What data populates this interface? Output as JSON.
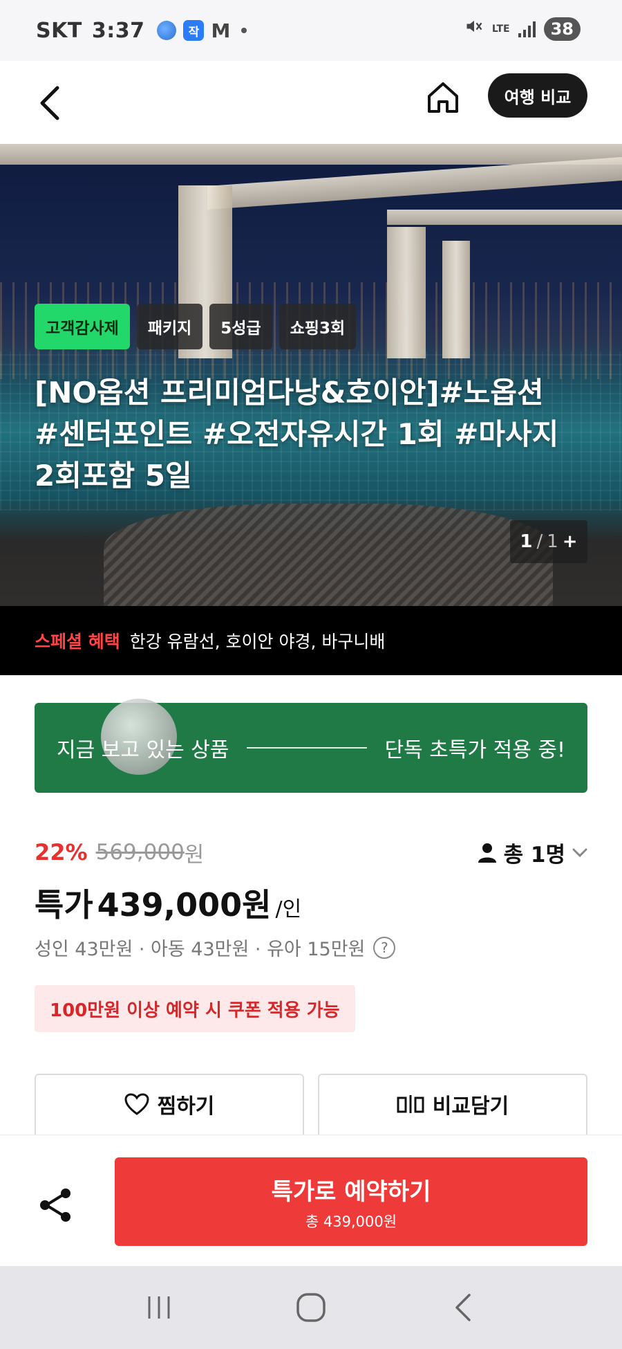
{
  "status_bar": {
    "carrier": "SKT",
    "time": "3:37",
    "app_icon_label": "작",
    "mail_icon_label": "M",
    "network": "LTE",
    "battery": "38",
    "icons": [
      "globe-icon",
      "app-icon",
      "gmail-icon",
      "notification-dot",
      "mute-icon",
      "lte-icon",
      "signal-icon",
      "battery-icon"
    ]
  },
  "header": {
    "back_icon": "chevron-left-icon",
    "home_icon": "home-icon",
    "compare_label": "여행 비교"
  },
  "hero": {
    "tags": [
      "고객감사제",
      "패키지",
      "5성급",
      "쇼핑3회"
    ],
    "title_lines": [
      "[NO옵션 프리미엄다낭&호이안]#노옵션",
      "#센터포인트 #오전자유시간 1회 #마사지",
      "2회포함 5일"
    ],
    "counter": {
      "current": "1",
      "total": "1",
      "plus": "+"
    }
  },
  "special": {
    "label": "스페셜 혜택",
    "text": "한강 유람선, 호이안 야경, 바구니배"
  },
  "promo": {
    "left": "지금 보고 있는 상품",
    "right": "단독 초특가 적용 중!"
  },
  "price": {
    "discount": "22%",
    "original": "569,000",
    "original_unit": "원",
    "pax_label": "총 1명",
    "special_prefix": "특가",
    "special_price": "439,000원",
    "per": "/인",
    "breakdown": "성인 43만원 · 아동 43만원 · 유아 15만원",
    "help": "?",
    "coupon": "100만원 이상 예약 시 쿠폰 적용 가능"
  },
  "actions": {
    "wish_label": "찜하기",
    "compare_label": "비교담기"
  },
  "bottom": {
    "reserve_label": "특가로 예약하기",
    "reserve_total": "총 439,000원",
    "share_icon": "share-icon"
  },
  "colors": {
    "accent_red": "#ee3a38",
    "discount_red": "#e8302f",
    "promo_green": "#1f7a46",
    "tag_green": "#22d86a",
    "dark_button": "#1a1a1a"
  }
}
